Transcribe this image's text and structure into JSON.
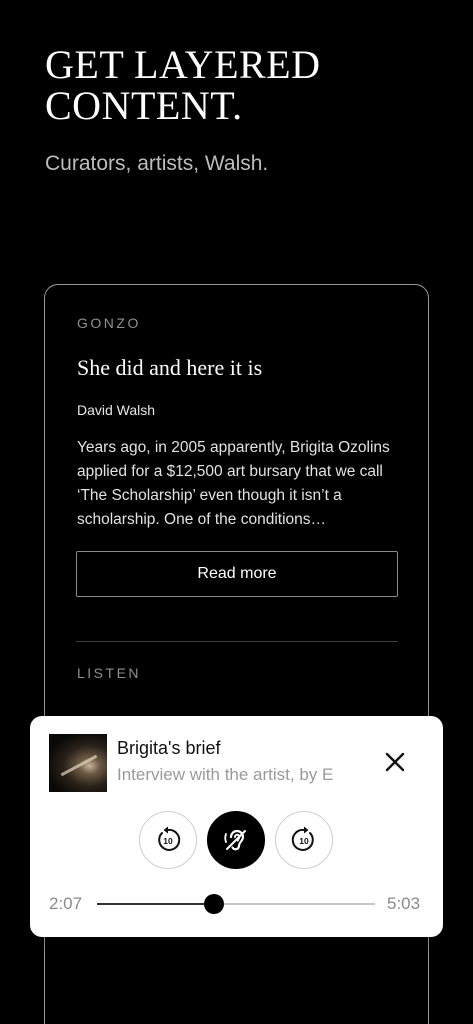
{
  "hero": {
    "title_line1": "GET LAYERED",
    "title_line2": "CONTENT.",
    "subtitle": "Curators, artists, Walsh."
  },
  "card": {
    "section_label": "GONZO",
    "title": "She did and here it is",
    "author": "David Walsh",
    "excerpt": "Years ago, in 2005 apparently, Brigita Ozolins applied for a $12,500 art bursary that we call ‘The Scholarship’ even though it isn’t a scholarship. One of the conditions…",
    "read_more_label": "Read more",
    "listen_label": "LISTEN"
  },
  "player": {
    "title": "Brigita's brief",
    "subtitle": "Interview with the artist, by E",
    "rewind_seconds": "10",
    "forward_seconds": "10",
    "elapsed": "2:07",
    "total": "5:03",
    "progress_fraction": 0.42,
    "accent_color": "#000000"
  },
  "icons": {
    "close": "close-icon",
    "rewind": "rewind-10-icon",
    "forward": "forward-10-icon",
    "main": "ear-listen-icon"
  }
}
